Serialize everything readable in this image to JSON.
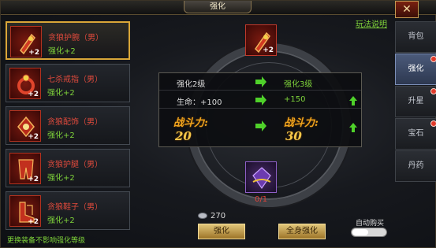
{
  "window": {
    "title": "强化",
    "close_glyph": "✕"
  },
  "help_link": "玩法说明",
  "equipment": [
    {
      "name": "贪狼护腕（男）",
      "level": "强化+2",
      "plus": "+2",
      "icon": "bracer-icon"
    },
    {
      "name": "七杀戒指（男）",
      "level": "强化+2",
      "plus": "+2",
      "icon": "ring-icon"
    },
    {
      "name": "贪狼配饰（男）",
      "level": "强化+2",
      "plus": "+2",
      "icon": "pendant-icon"
    },
    {
      "name": "贪狼护腿（男）",
      "level": "强化+2",
      "plus": "+2",
      "icon": "leggings-icon"
    },
    {
      "name": "贪狼鞋子（男）",
      "level": "强化+2",
      "plus": "+2",
      "icon": "boots-icon"
    }
  ],
  "footer_note": "更换装备不影响强化等级",
  "target": {
    "plus": "+2",
    "icon": "bracer-icon"
  },
  "stats": {
    "level_from": "强化2级",
    "level_to": "强化3级",
    "hp_from": "生命：+100",
    "hp_to": "+150",
    "power_label_from": "战斗力:",
    "power_from": "20",
    "power_label_to": "战斗力:",
    "power_to": "30"
  },
  "material": {
    "count": "0/1",
    "icon": "crystal-icon"
  },
  "coin": {
    "amount": "270",
    "icon": "silver-coin-icon"
  },
  "buttons": {
    "enhance": "强化",
    "enhance_all": "全身强化"
  },
  "auto_buy_label": "自动购买",
  "auto_buy_on": false,
  "tabs": [
    {
      "label": "背包",
      "active": false,
      "alert": false
    },
    {
      "label": "强化",
      "active": true,
      "alert": true
    },
    {
      "label": "升星",
      "active": false,
      "alert": true
    },
    {
      "label": "宝石",
      "active": false,
      "alert": true
    },
    {
      "label": "丹药",
      "active": false,
      "alert": false
    }
  ],
  "colors": {
    "accent_gold": "#d9a638",
    "green_text": "#7ed23a",
    "red_text": "#e04a3c",
    "power_orange": "#f1a51e"
  }
}
